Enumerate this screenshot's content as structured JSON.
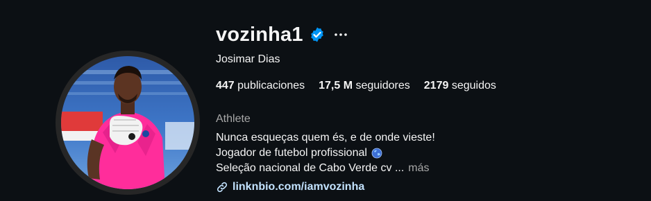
{
  "profile": {
    "username": "vozinha1",
    "full_name": "Josimar Dias",
    "category": "Athlete",
    "verified_icon": "verified-badge-icon",
    "more_icon": "more-options-icon"
  },
  "stats": {
    "posts_count": "447",
    "posts_label": "publicaciones",
    "followers_count": "17,5 M",
    "followers_label": "seguidores",
    "following_count": "2179",
    "following_label": "seguidos"
  },
  "bio": {
    "line1": "Nunca esqueças quem és, e de onde vieste!",
    "line2": "Jogador de futebol profissional",
    "line3": "Seleção nacional de Cabo Verde cv ...",
    "more_label": "más",
    "globe_icon": "globe-icon"
  },
  "link": {
    "text": "linknbio.com/iamvozinha",
    "icon": "link-icon"
  },
  "colors": {
    "background": "#0c1014",
    "text_primary": "#f5f5f5",
    "text_secondary": "#a8a8a8",
    "verified_blue": "#0095f6",
    "link_color": "#c3e3ff",
    "jersey_pink": "#ff2d9b"
  }
}
